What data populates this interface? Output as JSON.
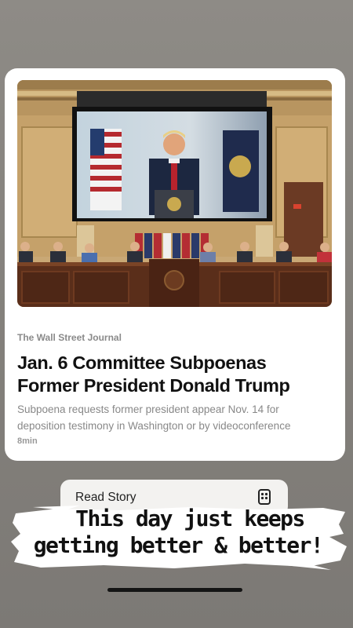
{
  "article": {
    "source": "The Wall Street Journal",
    "headline_line1": "Jan. 6 Committee Subpoenas",
    "headline_line2": "Former President Donald Trump",
    "summary_line1": "Subpoena requests former president appear Nov. 14 for",
    "summary_line2": "deposition testimony in Washington or by videoconference",
    "read_time": "8min"
  },
  "action": {
    "read_story_label": "Read Story",
    "icon": "news-reader-icon"
  },
  "caption": {
    "line1": "This day just keeps",
    "line2": "getting better & better!"
  }
}
